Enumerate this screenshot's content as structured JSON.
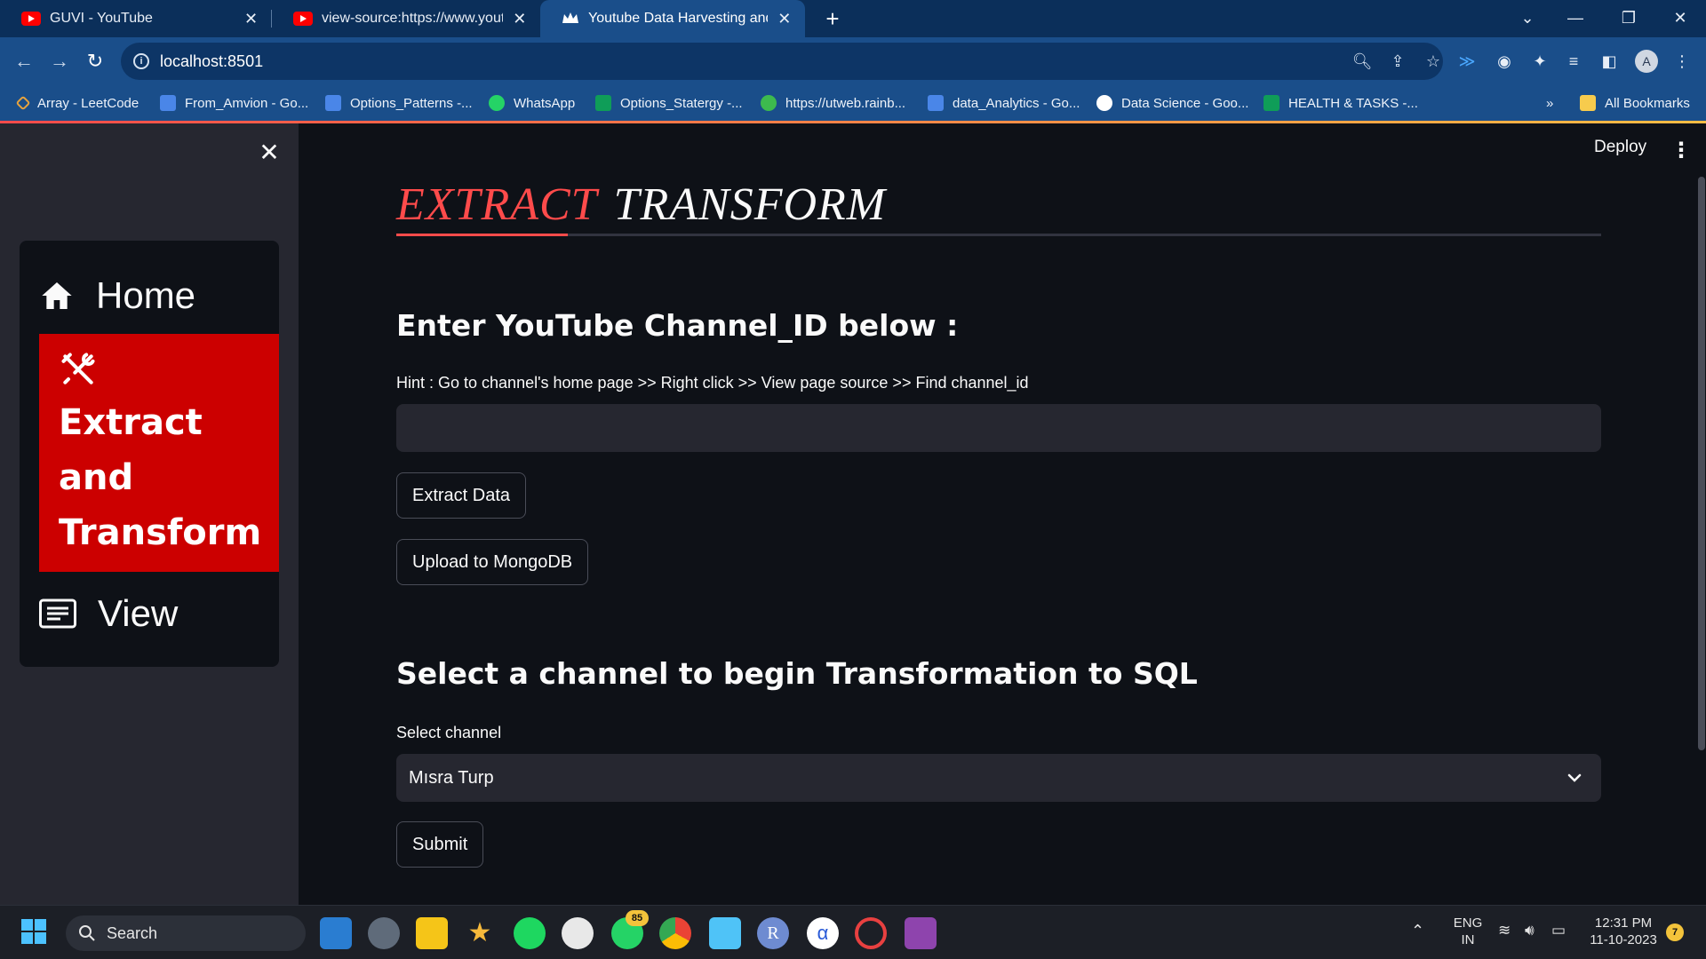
{
  "browser": {
    "tabs": [
      {
        "title": "GUVI - YouTube",
        "active": false,
        "icon": "youtube-icon"
      },
      {
        "title": "view-source:https://www.youtub",
        "active": false,
        "icon": "youtube-icon"
      },
      {
        "title": "Youtube Data Harvesting and W",
        "active": true,
        "icon": "streamlit-crown-icon"
      }
    ],
    "url": "localhost:8501",
    "bookmarks": [
      {
        "label": "Array - LeetCode",
        "icon": "leetcode-icon"
      },
      {
        "label": "From_Amvion - Go...",
        "icon": "google-docs-icon"
      },
      {
        "label": "Options_Patterns -...",
        "icon": "google-docs-icon"
      },
      {
        "label": "WhatsApp",
        "icon": "whatsapp-icon"
      },
      {
        "label": "Options_Statergy -...",
        "icon": "google-sheets-icon"
      },
      {
        "label": "https://utweb.rainb...",
        "icon": "utorrent-icon"
      },
      {
        "label": "data_Analytics - Go...",
        "icon": "google-docs-icon"
      },
      {
        "label": "Data Science - Goo...",
        "icon": "globe-icon"
      },
      {
        "label": "HEALTH & TASKS -...",
        "icon": "google-sheets-icon"
      }
    ],
    "bookmarks_overflow": "»",
    "all_bookmarks_label": "All Bookmarks",
    "profile_initial": "A"
  },
  "app": {
    "deploy_label": "Deploy",
    "sidebar": {
      "menu": [
        {
          "label": "Home",
          "icon": "house-icon",
          "active": false
        },
        {
          "label": "Extract and Transform",
          "icon": "tools-icon",
          "active": true
        },
        {
          "label": "View",
          "icon": "text-document-icon",
          "active": false
        }
      ],
      "active_lines": [
        "Extract",
        "and",
        "Transform"
      ]
    },
    "title_part1": "EXTRACT",
    "title_part2": "TRANSFORM",
    "section1_heading": "Enter YouTube Channel_ID below :",
    "hint": "Hint : Go to channel's home page >> Right click >> View page source >> Find channel_id",
    "channel_id_input_value": "",
    "extract_button": "Extract Data",
    "upload_button": "Upload to MongoDB",
    "section2_heading": "Select a channel to begin Transformation to SQL",
    "select_label": "Select channel",
    "select_value": "Mısra Turp",
    "submit_button": "Submit",
    "colors": {
      "accent": "#ff4b4b",
      "active_menu": "#cc0000",
      "background": "#0e1117",
      "sidebar": "#262730"
    }
  },
  "taskbar": {
    "search_placeholder": "Search",
    "whatsapp_badge": "85",
    "language": "ENG",
    "region": "IN",
    "time": "12:31 PM",
    "date": "11-10-2023",
    "notification_count": "7"
  }
}
